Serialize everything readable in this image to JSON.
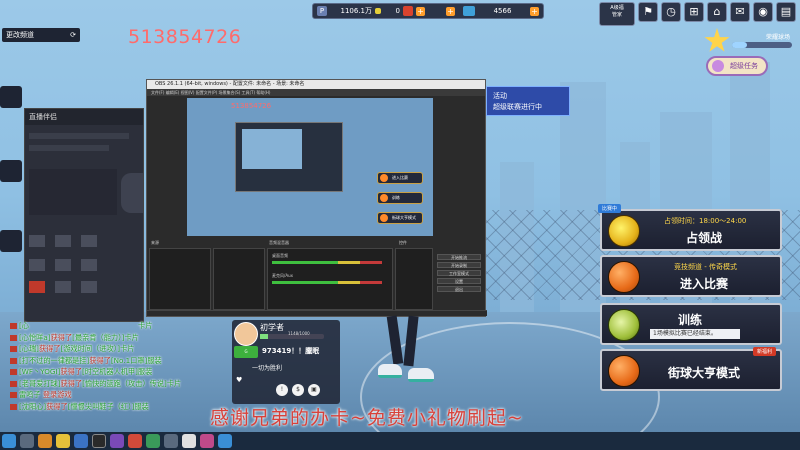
{
  "stream": {
    "room_id": "513854726"
  },
  "left_panel": {
    "change_channel": "更改频道"
  },
  "topbar": {
    "currency_p": "1106.1万",
    "currency_c": "0",
    "currency_r": "4566"
  },
  "top_icons": {
    "main_button": "A级福\n管家"
  },
  "honor": {
    "label": "荣耀球场",
    "task": "超级任务"
  },
  "event_banner": {
    "title": "活动",
    "text": "超级联赛进行中"
  },
  "cards": [
    {
      "tag": "比赛中",
      "sub": "占领时间：18:00～24:00",
      "main": "占领战"
    },
    {
      "sub": "竞技频道 - 传奇模式",
      "main": "进入比赛"
    },
    {
      "main": "训练",
      "note": "1场模拟比赛已经结束。"
    },
    {
      "newtag": "新福利",
      "main": "街球大亨模式"
    }
  ],
  "player": {
    "rank": "初学者",
    "xp_text": "1148/1000",
    "id": "973419！！臘眠",
    "motto": "一切为胜利"
  },
  "chat": [
    {
      "user": "[心",
      "mid": "",
      "item": "卡片"
    },
    {
      "user": "[心怡咩a]",
      "mid": "获得了",
      "item": "[最亲肯（能力）]卡片"
    },
    {
      "user": "[心瑞]",
      "mid": "获得了",
      "item": "[游戏时间（进攻）]卡片"
    },
    {
      "user": "[打不过的一律都是挂]",
      "mid": "获得了",
      "item": "[No.1口罩]服装"
    },
    {
      "user": "[WF丶YOGI]",
      "mid": "获得了",
      "item": "[时空机器人机甲]服装"
    },
    {
      "user": "[老哥爱打球]",
      "mid": "获得了",
      "item": "[愉快的篮跑（攻击）传说]卡片"
    },
    {
      "user": "雷鸣子",
      "mid": " 登录游戏",
      "item": ""
    },
    {
      "user": "[沈阳心]",
      "mid": "获得了",
      "item": "[憧憬尖叫鞋子（红）]服装"
    }
  ],
  "caption": "感谢兄弟的办卡~免费小礼物刷起~",
  "obs": {
    "title": "OBS 26.1.1 (64-bit, windows) - 配置文件: 未命名 - 场景: 未命名",
    "menu": "文件(F)  编辑(E)  视图(V)  配置文件(P)  场景集合(S)  工具(T)  帮助(H)",
    "stream_id": "513854726",
    "label_scenes": "来源",
    "label_mixer": "音频混音器",
    "label_controls": "控件",
    "controls": [
      "开始推流",
      "开始录制",
      "工作室模式",
      "设置",
      "退出"
    ],
    "mix_tracks": [
      "桌面音频",
      "麦克风/Aux"
    ],
    "preview_buttons": [
      "进入比赛",
      "训练",
      "街球大亨模式"
    ]
  },
  "assistant": {
    "title": "直播伴侣"
  },
  "colors": {
    "accent_red": "#d8413a",
    "chat_green": "#2aa235",
    "card_yellow": "#ffd84a"
  }
}
